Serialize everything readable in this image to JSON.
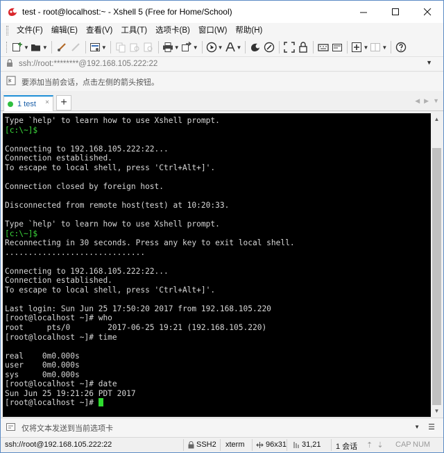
{
  "window": {
    "title": "test - root@localhost:~ - Xshell 5 (Free for Home/School)"
  },
  "menubar": {
    "items": [
      "文件(F)",
      "编辑(E)",
      "查看(V)",
      "工具(T)",
      "选项卡(B)",
      "窗口(W)",
      "帮助(H)"
    ]
  },
  "addressbar": {
    "address": "ssh://root:********@192.168.105.222:22"
  },
  "hintbar": {
    "text": "要添加当前会话，点击左侧的箭头按钮。"
  },
  "tabs": [
    {
      "label": "1 test",
      "status": "connected"
    }
  ],
  "terminal": {
    "lines": [
      {
        "text": "Type `help' to learn how to use Xshell prompt.",
        "color": "default"
      },
      {
        "text": "[c:\\~]$",
        "color": "green"
      },
      {
        "text": "",
        "color": "default"
      },
      {
        "text": "Connecting to 192.168.105.222:22...",
        "color": "default"
      },
      {
        "text": "Connection established.",
        "color": "default"
      },
      {
        "text": "To escape to local shell, press 'Ctrl+Alt+]'.",
        "color": "default"
      },
      {
        "text": "",
        "color": "default"
      },
      {
        "text": "Connection closed by foreign host.",
        "color": "default"
      },
      {
        "text": "",
        "color": "default"
      },
      {
        "text": "Disconnected from remote host(test) at 10:20:33.",
        "color": "default"
      },
      {
        "text": "",
        "color": "default"
      },
      {
        "text": "Type `help' to learn how to use Xshell prompt.",
        "color": "default"
      },
      {
        "text": "[c:\\~]$",
        "color": "green"
      },
      {
        "text": "Reconnecting in 30 seconds. Press any key to exit local shell.",
        "color": "default"
      },
      {
        "text": "..............................",
        "color": "default"
      },
      {
        "text": "",
        "color": "default"
      },
      {
        "text": "Connecting to 192.168.105.222:22...",
        "color": "default"
      },
      {
        "text": "Connection established.",
        "color": "default"
      },
      {
        "text": "To escape to local shell, press 'Ctrl+Alt+]'.",
        "color": "default"
      },
      {
        "text": "",
        "color": "default"
      },
      {
        "text": "Last login: Sun Jun 25 17:50:20 2017 from 192.168.105.220",
        "color": "default"
      },
      {
        "text": "[root@localhost ~]# who",
        "color": "default"
      },
      {
        "text": "root     pts/0        2017-06-25 19:21 (192.168.105.220)",
        "color": "default"
      },
      {
        "text": "[root@localhost ~]# time",
        "color": "default"
      },
      {
        "text": "",
        "color": "default"
      },
      {
        "text": "real    0m0.000s",
        "color": "default"
      },
      {
        "text": "user    0m0.000s",
        "color": "default"
      },
      {
        "text": "sys     0m0.000s",
        "color": "default"
      },
      {
        "text": "[root@localhost ~]# date",
        "color": "default"
      },
      {
        "text": "Sun Jun 25 19:21:26 PDT 2017",
        "color": "default"
      },
      {
        "text": "[root@localhost ~]# ",
        "color": "default",
        "cursor": true
      }
    ]
  },
  "composebar": {
    "placeholder": "仅将文本发送到当前选项卡"
  },
  "statusbar": {
    "connection": "ssh://root@192.168.105.222:22",
    "protocol": "SSH2",
    "terminal_type": "xterm",
    "size": "96x31",
    "cursor_pos": "31,21",
    "sessions": "1 会话",
    "caps": "CAP",
    "num": "NUM"
  },
  "colors": {
    "terminal_bg": "#000000",
    "terminal_fg": "#d7d7d7",
    "prompt_green": "#3ddc3d",
    "tab_accent": "#1e8fd6",
    "window_border": "#5c8bc4"
  }
}
